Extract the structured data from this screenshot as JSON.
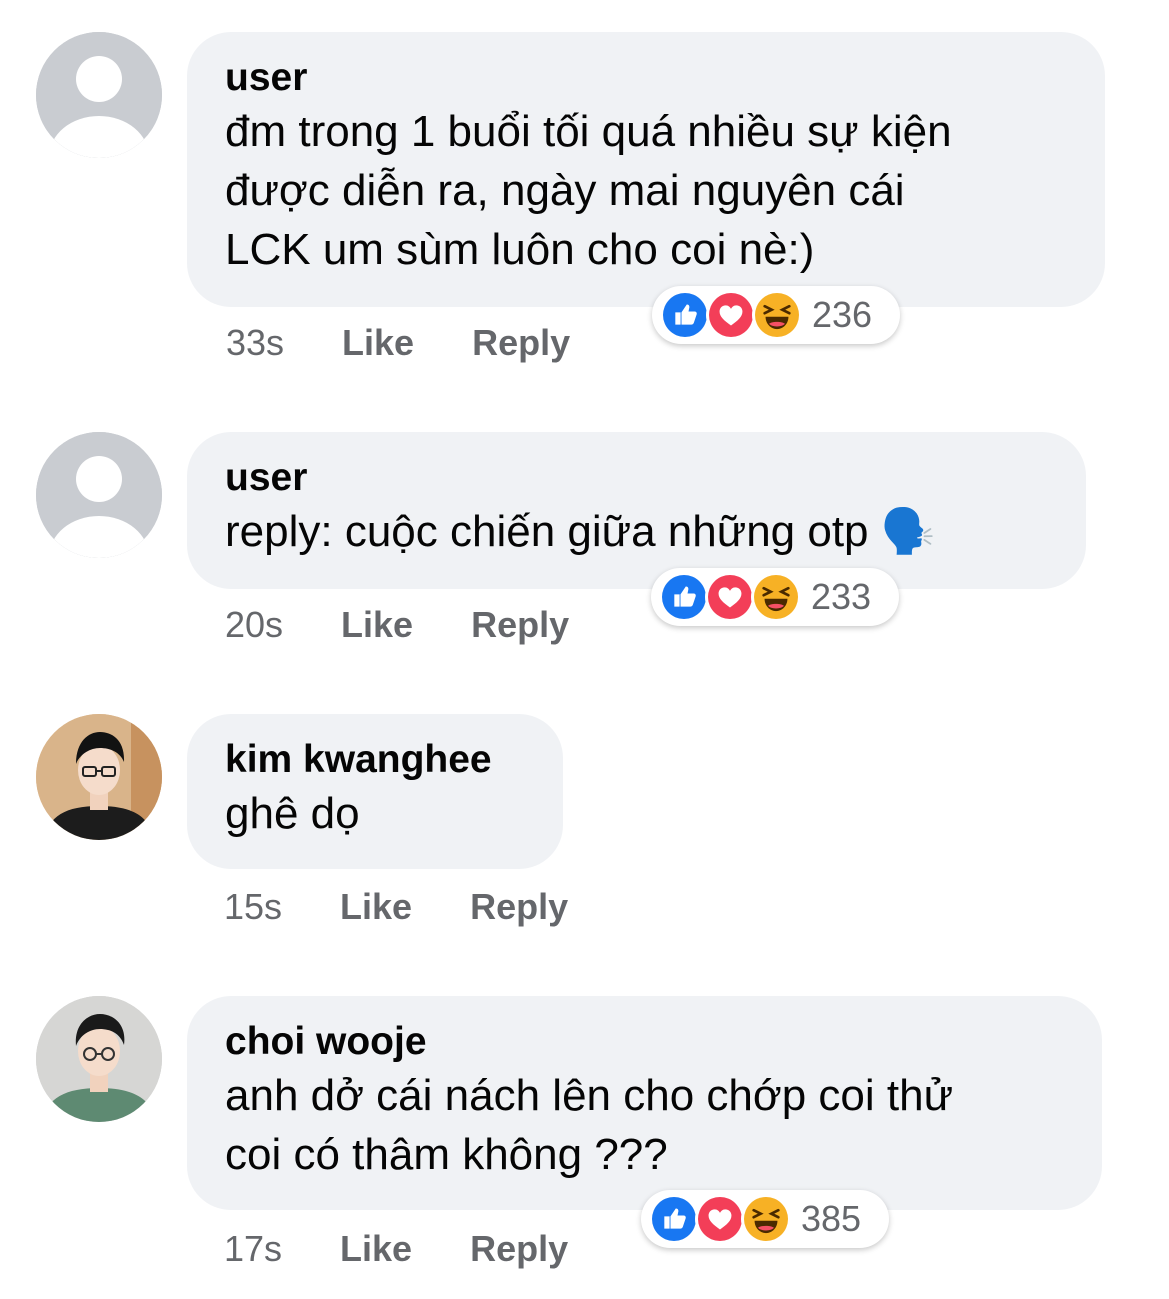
{
  "colors": {
    "bubble": "#f0f2f5",
    "meta_text": "#65676b",
    "like_blue": "#1877f2",
    "love_red": "#f33e58",
    "haha_yellow": "#f7b125"
  },
  "comments": [
    {
      "avatar": "default-user-avatar",
      "author": "user",
      "text": "đm trong 1 buổi tối quá nhiều sự kiện\nđược diễn ra, ngày mai nguyên cái\nLCK um sùm luôn cho coi nè:)",
      "time": "33s",
      "like": "Like",
      "reply": "Reply",
      "reactions": {
        "types": [
          "like",
          "love",
          "haha"
        ],
        "count": "236"
      }
    },
    {
      "avatar": "default-user-avatar",
      "author": "user",
      "text": "reply: cuộc chiến giữa những otp 🗣️",
      "time": "20s",
      "like": "Like",
      "reply": "Reply",
      "reactions": {
        "types": [
          "like",
          "love",
          "haha"
        ],
        "count": "233"
      }
    },
    {
      "avatar": "photo-avatar-man-glasses",
      "author": "kim kwanghee",
      "text": "ghê dọ",
      "time": "15s",
      "like": "Like",
      "reply": "Reply"
    },
    {
      "avatar": "photo-avatar-man-green-shirt",
      "author": "choi wooje",
      "text": "anh dở cái nách lên cho chớp coi thử\ncoi có thâm không ???",
      "time": "17s",
      "like": "Like",
      "reply": "Reply",
      "reactions": {
        "types": [
          "like",
          "love",
          "haha"
        ],
        "count": "385"
      }
    }
  ]
}
